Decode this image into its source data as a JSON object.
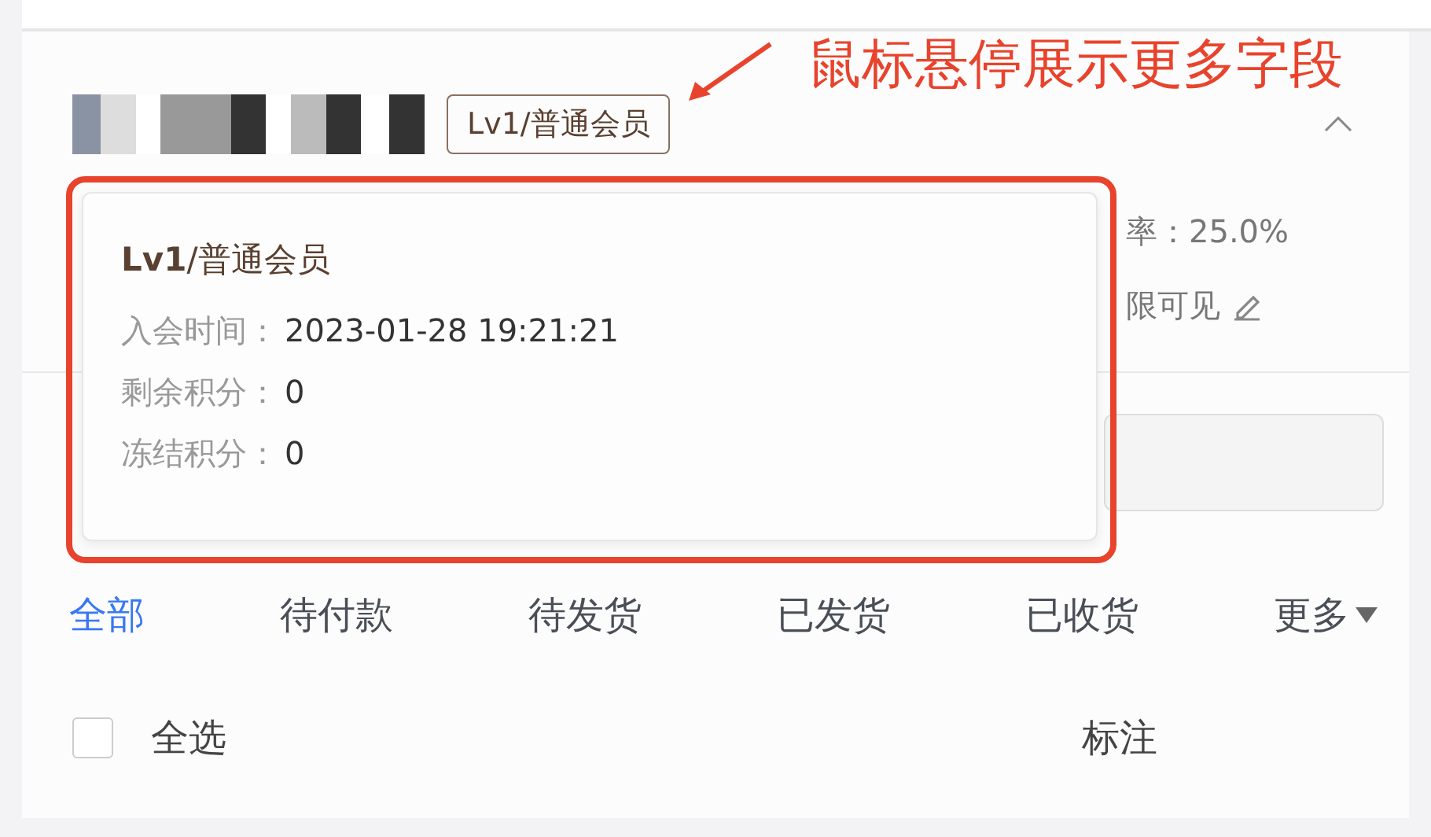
{
  "annotation": {
    "text": "鼠标悬停展示更多字段"
  },
  "member": {
    "level_badge": "Lv1/普通会员",
    "expanded": true
  },
  "stats": [
    {
      "text": "率：25.0%"
    },
    {
      "text": "限可见",
      "editable": true
    }
  ],
  "popover": {
    "title_bold": "Lv1",
    "title_rest": "/普通会员",
    "fields": [
      {
        "label": "入会时间：",
        "value": "2023-01-28 19:21:21"
      },
      {
        "label": "剩余积分：",
        "value": "0"
      },
      {
        "label": "冻结积分：",
        "value": "0"
      }
    ]
  },
  "tabs": [
    {
      "label": "全部",
      "selected": true
    },
    {
      "label": "待付款",
      "selected": false
    },
    {
      "label": "待发货",
      "selected": false
    },
    {
      "label": "已发货",
      "selected": false
    },
    {
      "label": "已收货",
      "selected": false
    },
    {
      "label": "更多",
      "selected": false,
      "dropdown": true
    }
  ],
  "select_all": {
    "label": "全选",
    "checked": false
  },
  "actions": [
    "标注"
  ]
}
